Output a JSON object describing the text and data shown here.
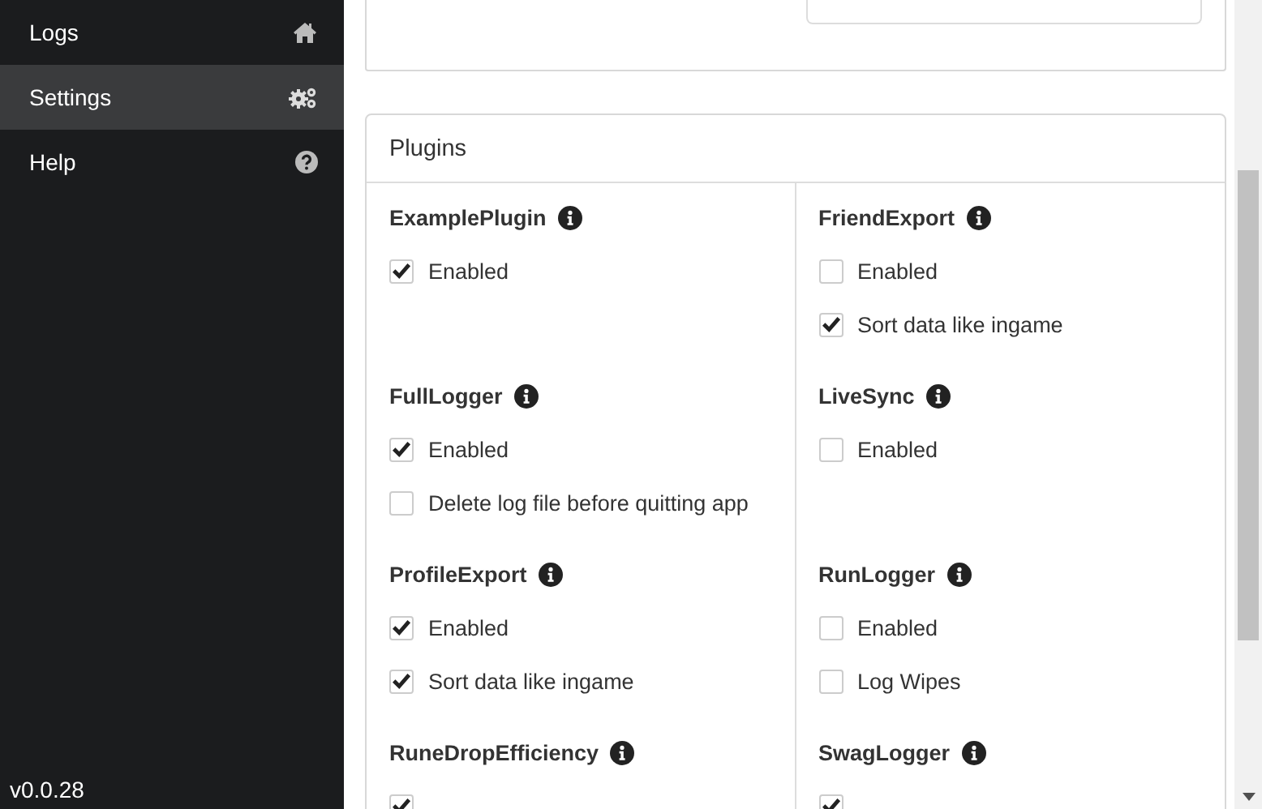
{
  "sidebar": {
    "items": [
      {
        "label": "Logs",
        "kind": "home",
        "selected": false
      },
      {
        "label": "Settings",
        "kind": "gears",
        "selected": true
      },
      {
        "label": "Help",
        "kind": "question",
        "selected": false
      }
    ],
    "version": "v0.0.28"
  },
  "plugins": {
    "title": "Plugins",
    "items": [
      {
        "name": "ExamplePlugin",
        "options": [
          {
            "label": "Enabled",
            "checked": true
          }
        ]
      },
      {
        "name": "FriendExport",
        "options": [
          {
            "label": "Enabled",
            "checked": false
          },
          {
            "label": "Sort data like ingame",
            "checked": true
          }
        ]
      },
      {
        "name": "FullLogger",
        "options": [
          {
            "label": "Enabled",
            "checked": true
          },
          {
            "label": "Delete log file before quitting app",
            "checked": false
          }
        ]
      },
      {
        "name": "LiveSync",
        "options": [
          {
            "label": "Enabled",
            "checked": false
          }
        ]
      },
      {
        "name": "ProfileExport",
        "options": [
          {
            "label": "Enabled",
            "checked": true
          },
          {
            "label": "Sort data like ingame",
            "checked": true
          }
        ]
      },
      {
        "name": "RunLogger",
        "options": [
          {
            "label": "Enabled",
            "checked": false
          },
          {
            "label": "Log Wipes",
            "checked": false
          }
        ]
      },
      {
        "name": "RuneDropEfficiency",
        "options": [
          {
            "checked": true
          }
        ]
      },
      {
        "name": "SwagLogger",
        "options": [
          {
            "checked": true
          }
        ]
      }
    ]
  }
}
